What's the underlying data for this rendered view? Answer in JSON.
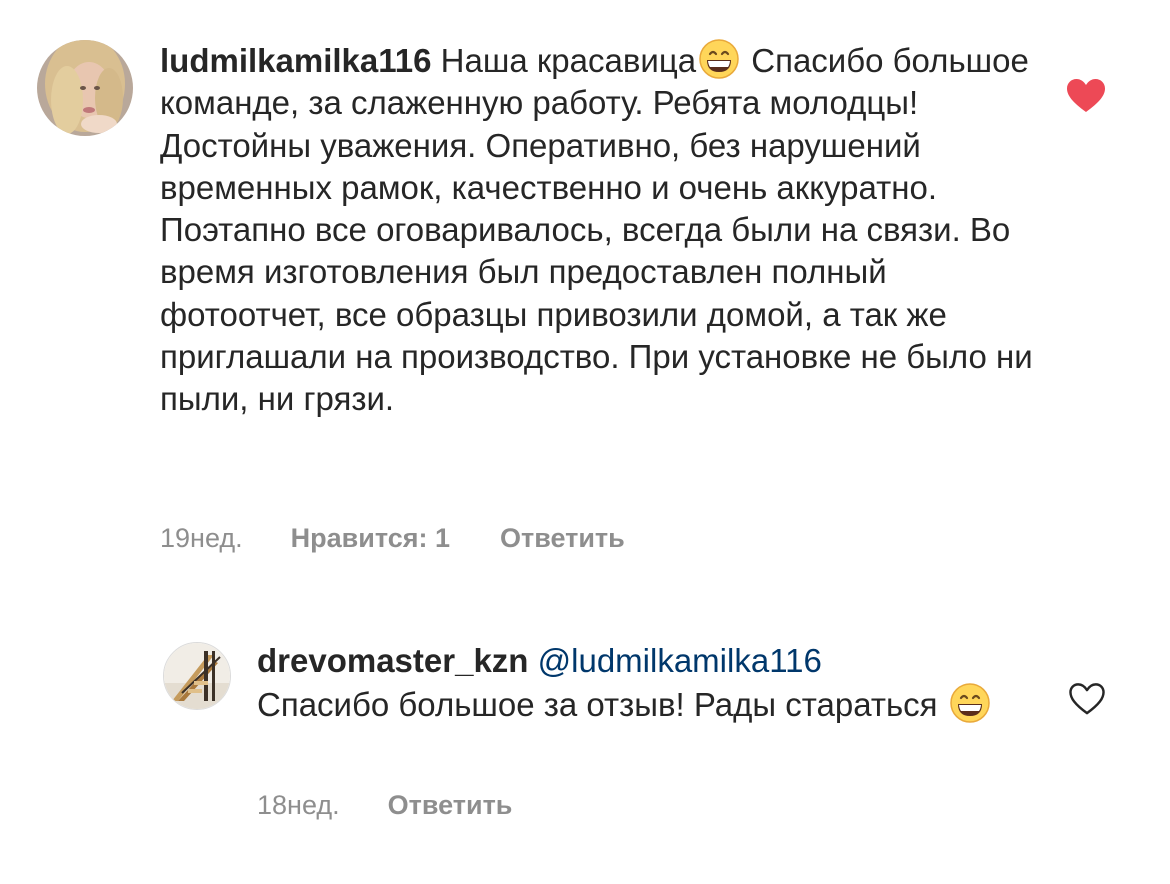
{
  "comment": {
    "username": "ludmilkamilka116",
    "text_before_emoji": "Наша красавица",
    "emoji": "grinning-face-with-smiling-eyes",
    "text_after_emoji": " Спасибо большое команде, за слаженную работу. Ребята молодцы! Достойны уважения. Оперативно, без нарушений временных рамок, качественно и очень аккуратно. Поэтапно все оговаривалось, всегда были на связи. Во время изготовления был предоставлен полный фотоотчет, все образцы привозили домой, а так же приглашали на производство. При установке не было ни пыли, ни грязи.",
    "time": "19нед.",
    "likes_label": "Нравится: 1",
    "reply_label": "Ответить",
    "liked": true,
    "heart_icon": "heart-filled-icon"
  },
  "reply": {
    "username": "drevomaster_kzn",
    "mention": "@ludmilkamilka116",
    "text": "Спасибо большое за отзыв! Рады стараться",
    "emoji": "grinning-face-with-smiling-eyes",
    "time": "18нед.",
    "reply_label": "Ответить",
    "liked": false,
    "heart_icon": "heart-outline-icon"
  },
  "colors": {
    "text": "#262626",
    "secondary": "#8e8e8e",
    "mention": "#00376b",
    "heart_liked": "#ed4956"
  }
}
